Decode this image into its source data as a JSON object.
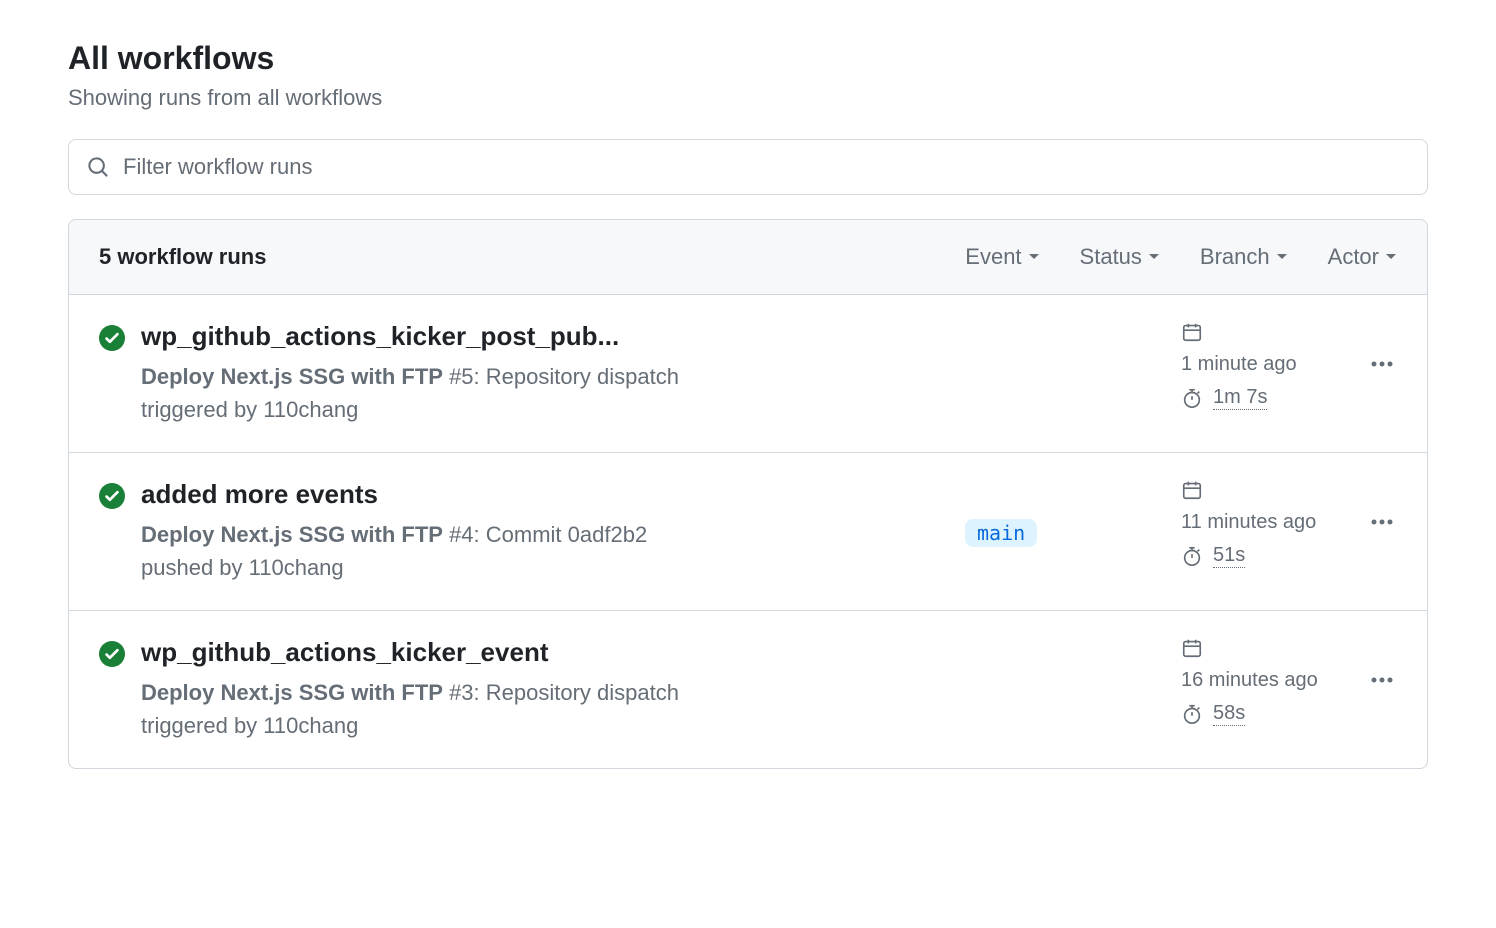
{
  "header": {
    "title": "All workflows",
    "subtitle": "Showing runs from all workflows"
  },
  "search": {
    "placeholder": "Filter workflow runs"
  },
  "table": {
    "count_label": "5 workflow runs",
    "filters": {
      "event": "Event",
      "status": "Status",
      "branch": "Branch",
      "actor": "Actor"
    }
  },
  "runs": [
    {
      "title": "wp_github_actions_kicker_post_pub...",
      "workflow": "Deploy Next.js SSG with FTP",
      "description_suffix": " #5: Repository dispatch triggered by 110chang",
      "branch": "",
      "time_ago": "1 minute ago",
      "duration": "1m 7s"
    },
    {
      "title": "added more events",
      "workflow": "Deploy Next.js SSG with FTP",
      "description_suffix": " #4: Commit 0adf2b2 pushed by 110chang",
      "branch": "main",
      "time_ago": "11 minutes ago",
      "duration": "51s"
    },
    {
      "title": "wp_github_actions_kicker_event",
      "workflow": "Deploy Next.js SSG with FTP",
      "description_suffix": " #3: Repository dispatch triggered by 110chang",
      "branch": "",
      "time_ago": "16 minutes ago",
      "duration": "58s"
    }
  ]
}
